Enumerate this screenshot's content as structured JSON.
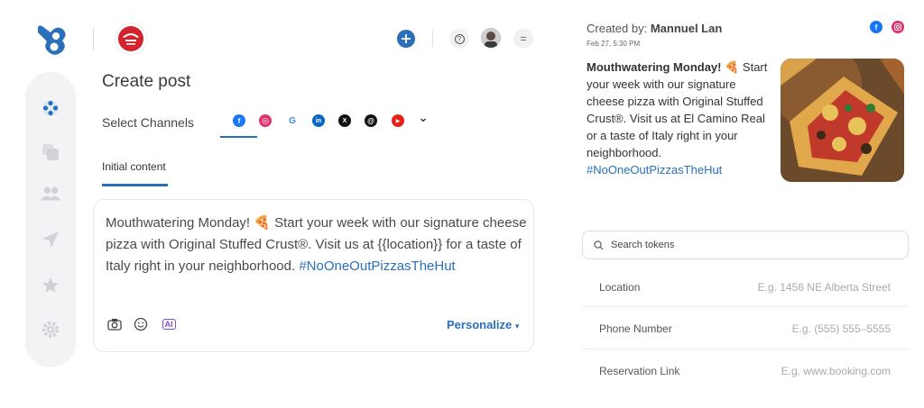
{
  "header": {
    "help_glyph": "?",
    "menu_glyph": "="
  },
  "sidebar": {
    "items": [
      {
        "icon": "channels-icon",
        "active": true
      },
      {
        "icon": "posts-icon"
      },
      {
        "icon": "users-icon"
      },
      {
        "icon": "send-icon"
      },
      {
        "icon": "star-icon"
      },
      {
        "icon": "settings-icon"
      }
    ]
  },
  "main": {
    "title": "Create post",
    "select_channels_label": "Select Channels",
    "channels": [
      "facebook-icon",
      "instagram-icon",
      "google-icon",
      "linkedin-icon",
      "x-icon",
      "threads-icon",
      "youtube-icon",
      "chevron-down-icon"
    ],
    "channel_glyphs": {
      "facebook": "f",
      "instagram": "◎",
      "google": "G",
      "linkedin": "in",
      "x": "X",
      "threads": "@",
      "youtube": "▶",
      "chevron": "⌄"
    },
    "tab_label": "Initial content",
    "editor": {
      "text": "Mouthwatering Monday! 🍕 Start your week with our signature cheese pizza with Original Stuffed Crust®. Visit us at {{location}} for a taste of Italy right in your neighborhood. ",
      "hashtag": "#NoOneOutPizzasTheHut",
      "ai_label": "AI",
      "personalize_label": "Personalize",
      "personalize_caret": "▾"
    }
  },
  "preview": {
    "created_by_label": "Created by: ",
    "created_by_name": "Mannuel Lan",
    "date": "Feb 27, 5:30 PM",
    "bold_text": "Mouthwatering Monday!",
    "body": " 🍕 Start your week with our signature cheese pizza with Original Stuffed Crust®. Visit us at El Camino Real or a taste of Italy right in your neighborhood.",
    "hashtag": "#NoOneOutPizzasTheHut",
    "facebook_glyph": "f"
  },
  "tokens": {
    "search_placeholder": "Search tokens",
    "rows": [
      {
        "label": "Location",
        "example": "E.g. 1456 NE Alberta Street"
      },
      {
        "label": "Phone Number",
        "example": "E.g. (555) 555–5555"
      },
      {
        "label": "Reservation Link",
        "example": "E.g. www.booking.com"
      }
    ]
  },
  "colors": {
    "accent": "#2a6fb8",
    "brand_red": "#d3232d",
    "sidebar_bg": "#f2f3f5"
  }
}
